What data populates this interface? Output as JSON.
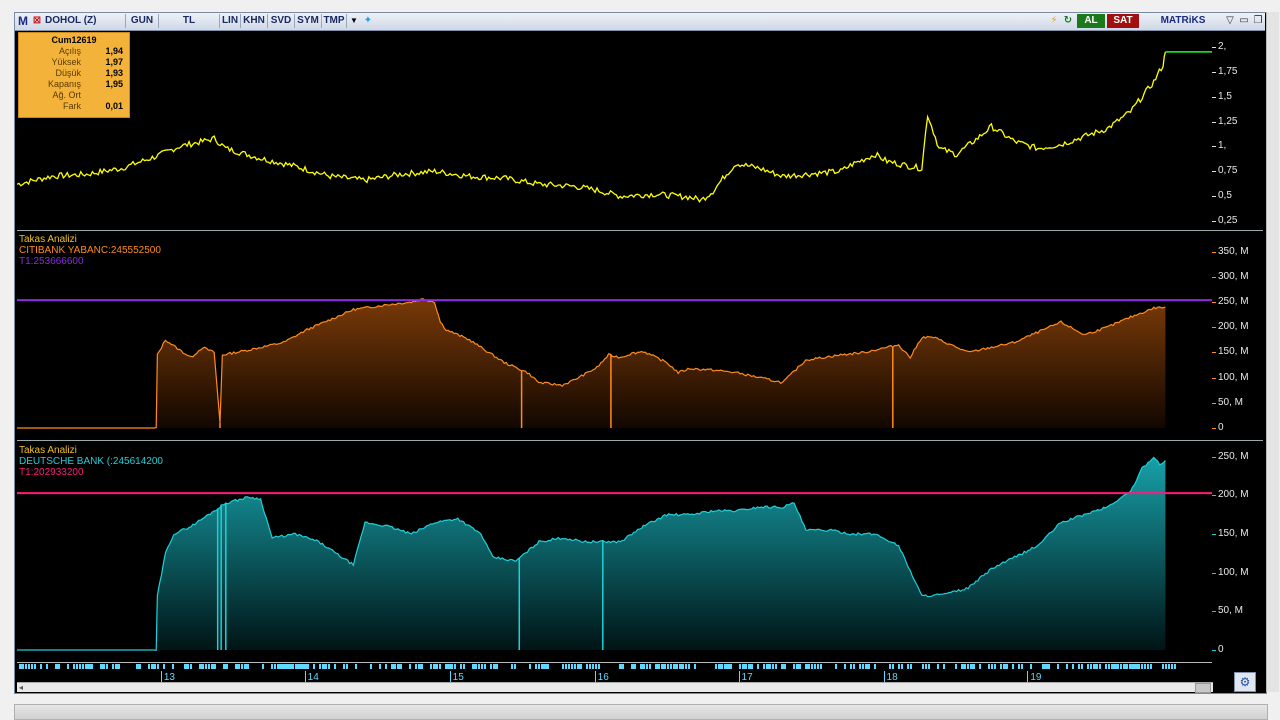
{
  "toolbar": {
    "logo": "M",
    "symbol": "DOHOL (Z)",
    "period": "GUN",
    "currency": "TL",
    "buttons": [
      "LIN",
      "KHN",
      "SVD",
      "SYM",
      "TMP"
    ],
    "buy_label": "AL",
    "sell_label": "SAT",
    "brand": "MATRiKS"
  },
  "colors": {
    "price": "#ffff00",
    "citi": "#ff8c1a",
    "citi_ref": "#8a2be2",
    "deutsche": "#1fd0d8",
    "deutsche_ref": "#ff1a7a",
    "info_bg": "#f3b33a"
  },
  "infobox": {
    "date": "Cum12619",
    "rows": [
      {
        "label": "Açılış",
        "value": "1,94"
      },
      {
        "label": "Yüksek",
        "value": "1,97"
      },
      {
        "label": "Düşük",
        "value": "1,93"
      },
      {
        "label": "Kapanış",
        "value": "1,95"
      },
      {
        "label": "Ağ. Ort",
        "value": ""
      },
      {
        "label": "Fark",
        "value": "0,01"
      }
    ]
  },
  "panels": {
    "citi": {
      "title": "Takas Analizi",
      "series_label": "CITIBANK YABANC:245552500",
      "ref_label": "T1:253666600"
    },
    "deutsche": {
      "title": "Takas Analizi",
      "series_label": "DEUTSCHE BANK (:245614200",
      "ref_label": "T1:202933200"
    }
  },
  "axes": {
    "price": [
      "2,",
      "1,75",
      "1,5",
      "1,25",
      "1,",
      "0,75",
      "0,5",
      "0,25"
    ],
    "citi": [
      "350, M",
      "300, M",
      "250, M",
      "200, M",
      "150, M",
      "100, M",
      "50, M",
      "0"
    ],
    "deutsche": [
      "250, M",
      "200, M",
      "150, M",
      "100, M",
      "50, M",
      "0"
    ]
  },
  "timebar": {
    "days": [
      "13",
      "14",
      "15",
      "16",
      "17",
      "18",
      "19"
    ]
  },
  "chart_data": [
    {
      "type": "line",
      "name": "DOHOL (Z)",
      "ylim": [
        0.2,
        2.1
      ],
      "x_range": [
        0,
        100
      ],
      "points": [
        [
          0,
          0.62
        ],
        [
          3,
          0.7
        ],
        [
          6,
          0.72
        ],
        [
          9,
          0.78
        ],
        [
          12,
          0.9
        ],
        [
          14,
          1.0
        ],
        [
          16,
          1.05
        ],
        [
          17,
          1.08
        ],
        [
          18,
          0.98
        ],
        [
          21,
          0.88
        ],
        [
          24,
          0.8
        ],
        [
          27,
          0.7
        ],
        [
          30,
          0.66
        ],
        [
          33,
          0.72
        ],
        [
          36,
          0.75
        ],
        [
          39,
          0.7
        ],
        [
          42,
          0.68
        ],
        [
          45,
          0.62
        ],
        [
          48,
          0.6
        ],
        [
          50,
          0.56
        ],
        [
          52,
          0.5
        ],
        [
          55,
          0.52
        ],
        [
          58,
          0.49
        ],
        [
          59,
          0.46
        ],
        [
          60,
          0.55
        ],
        [
          61,
          0.7
        ],
        [
          62,
          0.83
        ],
        [
          64,
          0.78
        ],
        [
          66,
          0.7
        ],
        [
          68,
          0.72
        ],
        [
          71,
          0.75
        ],
        [
          72,
          0.82
        ],
        [
          74,
          0.92
        ],
        [
          75,
          0.85
        ],
        [
          77,
          0.8
        ],
        [
          78,
          0.78
        ],
        [
          78.5,
          1.32
        ],
        [
          79.5,
          0.98
        ],
        [
          81,
          0.92
        ],
        [
          83,
          1.1
        ],
        [
          84,
          1.2
        ],
        [
          86,
          1.05
        ],
        [
          88,
          0.98
        ],
        [
          90,
          1.02
        ],
        [
          92,
          1.1
        ],
        [
          94,
          1.18
        ],
        [
          96,
          1.35
        ],
        [
          98,
          1.65
        ],
        [
          98.8,
          1.82
        ],
        [
          99,
          1.95
        ]
      ],
      "last_value": 1.95
    },
    {
      "type": "area",
      "name": "CITIBANK YABANC",
      "ylim": [
        0,
        375
      ],
      "x_range": [
        0,
        100
      ],
      "reference": 253.67,
      "points": [
        [
          0,
          0
        ],
        [
          12,
          0
        ],
        [
          12.1,
          145
        ],
        [
          12.8,
          175
        ],
        [
          14,
          155
        ],
        [
          15,
          140
        ],
        [
          16,
          160
        ],
        [
          17,
          150
        ],
        [
          17.5,
          10
        ],
        [
          17.7,
          145
        ],
        [
          20,
          155
        ],
        [
          23,
          170
        ],
        [
          25,
          195
        ],
        [
          27,
          215
        ],
        [
          29,
          235
        ],
        [
          32,
          245
        ],
        [
          34,
          250
        ],
        [
          35,
          256
        ],
        [
          36,
          250
        ],
        [
          36.5,
          210
        ],
        [
          37,
          195
        ],
        [
          39,
          175
        ],
        [
          40,
          160
        ],
        [
          42,
          130
        ],
        [
          44,
          110
        ],
        [
          45,
          90
        ],
        [
          47,
          85
        ],
        [
          48,
          95
        ],
        [
          50,
          120
        ],
        [
          51,
          145
        ],
        [
          52,
          140
        ],
        [
          53,
          148
        ],
        [
          54,
          152
        ],
        [
          56,
          130
        ],
        [
          57,
          110
        ],
        [
          58,
          118
        ],
        [
          60,
          115
        ],
        [
          62,
          110
        ],
        [
          64,
          100
        ],
        [
          66,
          90
        ],
        [
          68,
          135
        ],
        [
          71,
          145
        ],
        [
          73,
          150
        ],
        [
          75,
          160
        ],
        [
          76,
          165
        ],
        [
          77,
          140
        ],
        [
          78,
          180
        ],
        [
          79,
          180
        ],
        [
          80,
          170
        ],
        [
          82,
          150
        ],
        [
          84,
          160
        ],
        [
          86,
          170
        ],
        [
          88,
          190
        ],
        [
          90,
          210
        ],
        [
          92,
          185
        ],
        [
          94,
          200
        ],
        [
          96,
          220
        ],
        [
          98,
          238
        ],
        [
          99,
          240
        ]
      ],
      "spikes": [
        [
          17.5,
          0
        ],
        [
          43.5,
          0
        ],
        [
          51.2,
          0
        ],
        [
          75.5,
          0
        ]
      ],
      "last_value": 245.55
    },
    {
      "type": "area",
      "name": "DEUTSCHE BANK",
      "ylim": [
        0,
        260
      ],
      "x_range": [
        0,
        100
      ],
      "reference": 202.93,
      "points": [
        [
          0,
          0
        ],
        [
          12,
          0
        ],
        [
          12.1,
          70
        ],
        [
          12.8,
          125
        ],
        [
          13.5,
          150
        ],
        [
          15,
          160
        ],
        [
          17,
          180
        ],
        [
          18,
          190
        ],
        [
          20,
          198
        ],
        [
          21,
          195
        ],
        [
          22,
          145
        ],
        [
          24,
          150
        ],
        [
          26,
          140
        ],
        [
          28,
          120
        ],
        [
          29,
          110
        ],
        [
          30,
          165
        ],
        [
          32,
          160
        ],
        [
          34,
          150
        ],
        [
          36,
          165
        ],
        [
          38,
          170
        ],
        [
          40,
          150
        ],
        [
          41,
          120
        ],
        [
          43,
          115
        ],
        [
          45,
          140
        ],
        [
          47,
          145
        ],
        [
          49,
          140
        ],
        [
          52,
          140
        ],
        [
          54,
          160
        ],
        [
          56,
          175
        ],
        [
          58,
          175
        ],
        [
          60,
          180
        ],
        [
          62,
          180
        ],
        [
          64,
          185
        ],
        [
          66,
          185
        ],
        [
          67,
          190
        ],
        [
          68,
          155
        ],
        [
          70,
          155
        ],
        [
          72,
          150
        ],
        [
          74,
          150
        ],
        [
          76,
          135
        ],
        [
          78,
          70
        ],
        [
          80,
          72
        ],
        [
          82,
          80
        ],
        [
          84,
          105
        ],
        [
          86,
          120
        ],
        [
          88,
          135
        ],
        [
          90,
          165
        ],
        [
          92,
          175
        ],
        [
          94,
          185
        ],
        [
          96,
          205
        ],
        [
          97,
          235
        ],
        [
          98,
          250
        ],
        [
          98.5,
          240
        ],
        [
          99,
          245
        ]
      ],
      "spikes": [
        [
          17.3,
          0
        ],
        [
          17.6,
          0
        ],
        [
          18.0,
          0
        ],
        [
          43.3,
          0
        ],
        [
          50.5,
          0
        ]
      ],
      "last_value": 245.61
    }
  ]
}
